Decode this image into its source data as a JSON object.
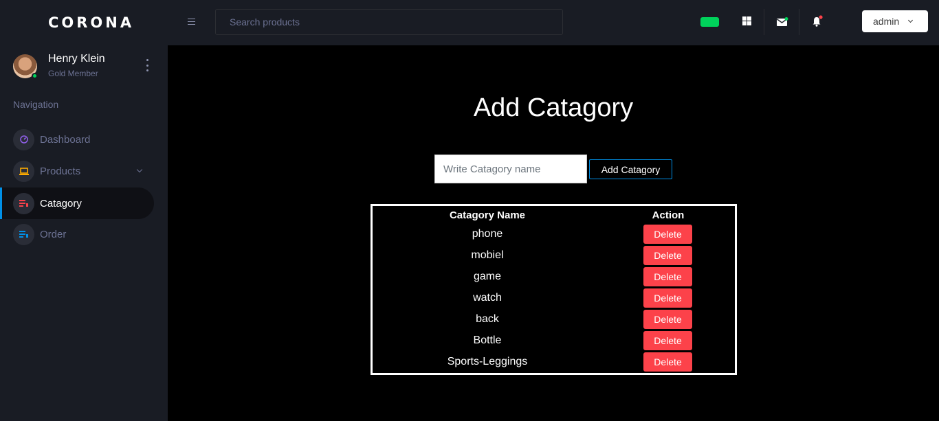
{
  "brand": "CORONA",
  "profile": {
    "name": "Henry Klein",
    "subtitle": "Gold Member"
  },
  "nav": {
    "title": "Navigation",
    "items": [
      {
        "label": "Dashboard",
        "icon": "speedometer-icon"
      },
      {
        "label": "Products",
        "icon": "laptop-icon"
      },
      {
        "label": "Catagory",
        "icon": "playlist-icon"
      },
      {
        "label": "Order",
        "icon": "list-icon"
      }
    ]
  },
  "topbar": {
    "search_placeholder": "Search products",
    "user_label": "admin"
  },
  "main": {
    "title": "Add Catagory",
    "input_placeholder": "Write Catagory name",
    "add_button": "Add Catagory",
    "table": {
      "headers": [
        "Catagory Name",
        "Action"
      ],
      "rows": [
        {
          "name": "phone",
          "action": "Delete"
        },
        {
          "name": "mobiel",
          "action": "Delete"
        },
        {
          "name": "game",
          "action": "Delete"
        },
        {
          "name": "watch",
          "action": "Delete"
        },
        {
          "name": "back",
          "action": "Delete"
        },
        {
          "name": "Bottle",
          "action": "Delete"
        },
        {
          "name": "Sports-Leggings",
          "action": "Delete"
        }
      ]
    }
  },
  "colors": {
    "sidebar": "#191c24",
    "accent": "#0090e7",
    "danger": "#fc424a",
    "success": "#00d25b"
  }
}
